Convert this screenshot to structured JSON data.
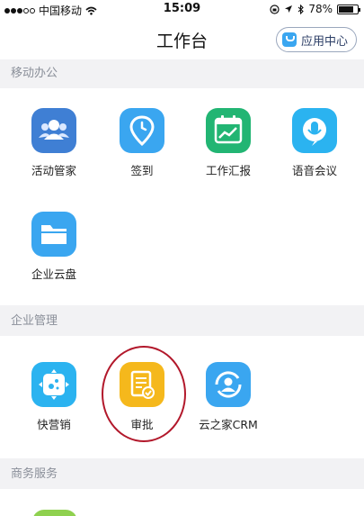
{
  "status_bar": {
    "carrier": "中国移动",
    "time": "15:09",
    "battery": "78%",
    "battery_level": 0.78
  },
  "nav": {
    "title": "工作台",
    "app_center_label": "应用中心"
  },
  "sections": [
    {
      "title": "移动办公",
      "items": [
        {
          "label": "活动管家",
          "icon": "people-group-icon",
          "color": "#3f7fd4"
        },
        {
          "label": "签到",
          "icon": "location-pin-icon",
          "color": "#3aa6f0"
        },
        {
          "label": "工作汇报",
          "icon": "calendar-chart-icon",
          "color": "#22b573"
        },
        {
          "label": "语音会议",
          "icon": "microphone-icon",
          "color": "#2bb3f0"
        },
        {
          "label": "企业云盘",
          "icon": "folder-icon",
          "color": "#3aa6f0"
        }
      ]
    },
    {
      "title": "企业管理",
      "items": [
        {
          "label": "快营销",
          "icon": "marketing-icon",
          "color": "#2bb3f0"
        },
        {
          "label": "审批",
          "icon": "approval-document-icon",
          "color": "#f5b81c"
        },
        {
          "label": "云之家CRM",
          "icon": "crm-contact-icon",
          "color": "#3aa6f0"
        }
      ]
    },
    {
      "title": "商务服务",
      "items": []
    }
  ]
}
